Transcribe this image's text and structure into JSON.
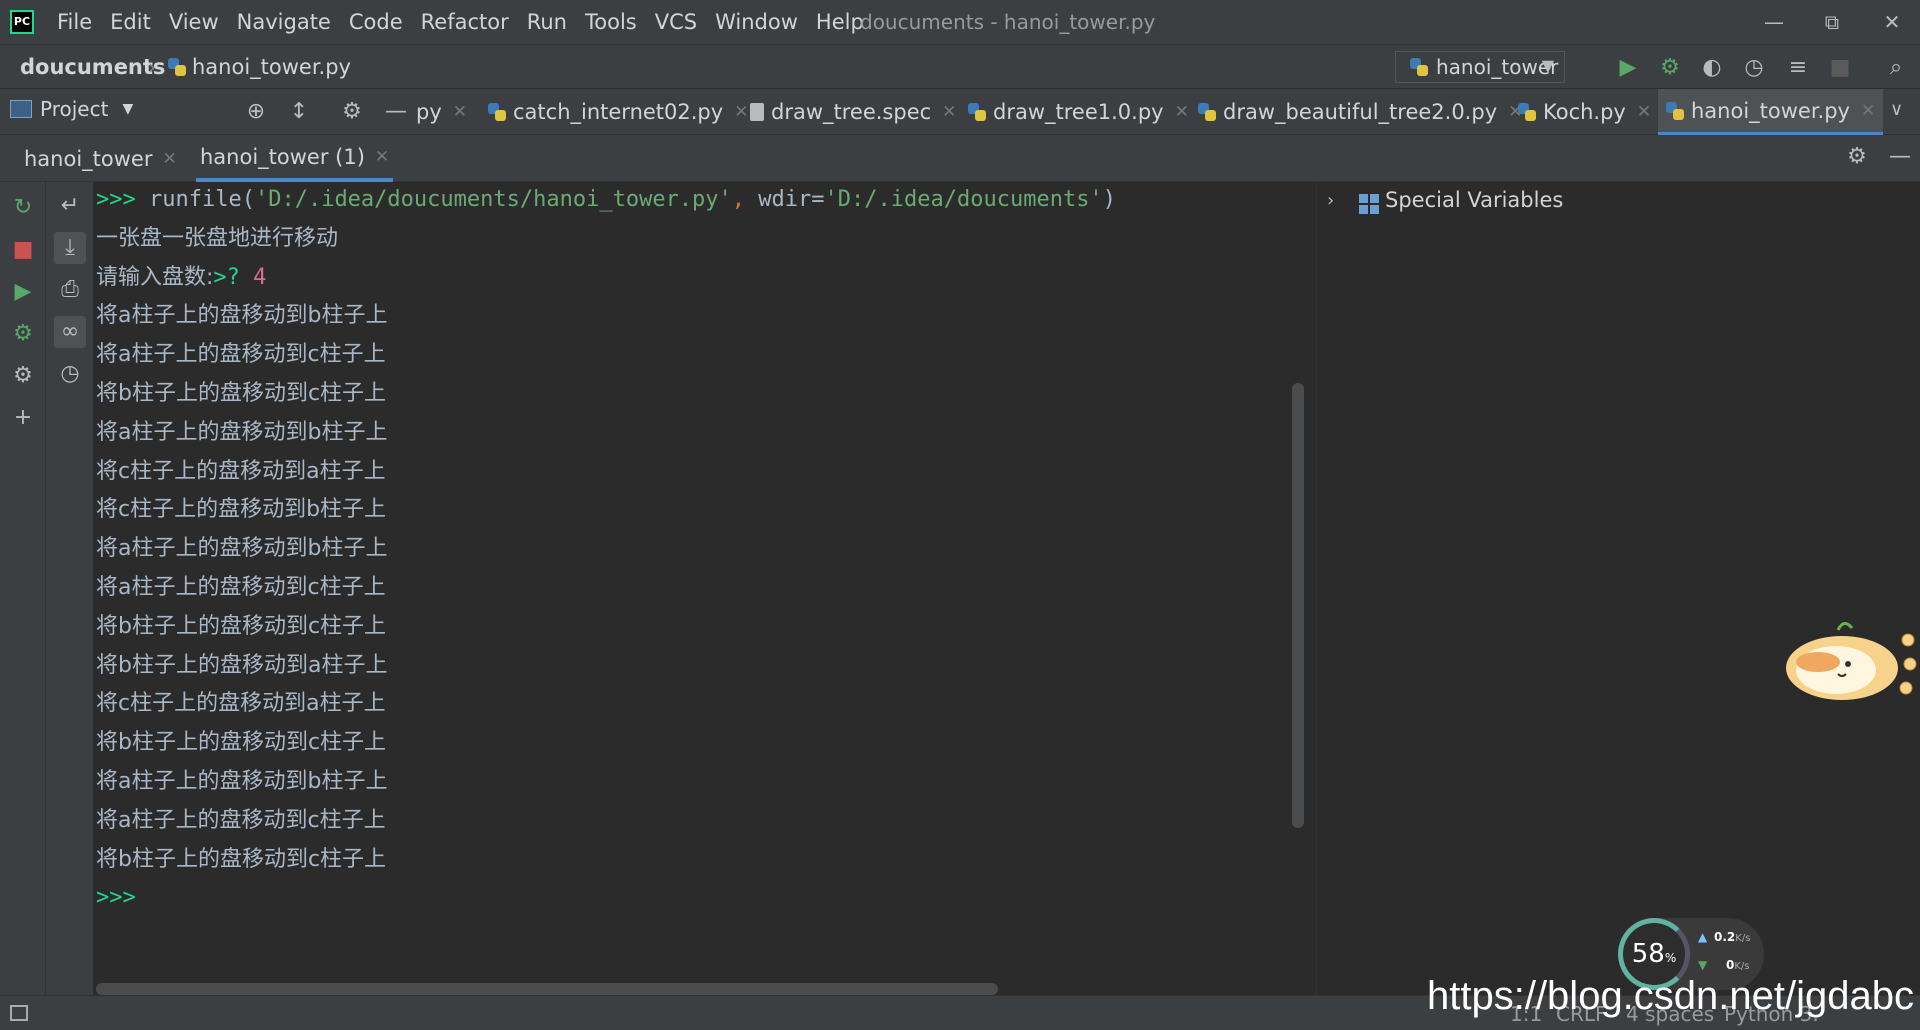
{
  "app": {
    "logo": "PC",
    "menu": [
      "File",
      "Edit",
      "View",
      "Navigate",
      "Code",
      "Refactor",
      "Run",
      "Tools",
      "VCS",
      "Window",
      "Help"
    ],
    "window_title": "doucuments - hanoi_tower.py"
  },
  "nav": {
    "root": "doucuments",
    "file": "hanoi_tower.py",
    "run_config": "hanoi_tower"
  },
  "tabs": {
    "project_label": "Project",
    "editor_tabs": [
      {
        "label": "py",
        "icon": "python-file-icon"
      },
      {
        "label": "catch_internet02.py",
        "icon": "python-file-icon"
      },
      {
        "label": "draw_tree.spec",
        "icon": "text-file-icon"
      },
      {
        "label": "draw_tree1.0.py",
        "icon": "python-file-icon"
      },
      {
        "label": "draw_beautiful_tree2.0.py",
        "icon": "python-file-icon"
      },
      {
        "label": "Koch.py",
        "icon": "python-file-icon"
      },
      {
        "label": "hanoi_tower.py",
        "icon": "python-file-icon",
        "active": true
      }
    ]
  },
  "console_tabs": [
    "hanoi_tower",
    "hanoi_tower (1)"
  ],
  "console": {
    "prompt": ">>>",
    "cmd_prefix": " runfile(",
    "cmd_path": "'D:/.idea/doucuments/hanoi_tower.py'",
    "cmd_comma": ", ",
    "cmd_kw": "wdir=",
    "cmd_wdir": "'D:/.idea/doucuments'",
    "cmd_suffix": ")",
    "intro": "一张盘一张盘地进行移动",
    "input_prompt": "请输入盘数:",
    "input_marker": ">? ",
    "input_value": "4",
    "moves": [
      "将a柱子上的盘移动到b柱子上",
      "将a柱子上的盘移动到c柱子上",
      "将b柱子上的盘移动到c柱子上",
      "将a柱子上的盘移动到b柱子上",
      "将c柱子上的盘移动到a柱子上",
      "将c柱子上的盘移动到b柱子上",
      "将a柱子上的盘移动到b柱子上",
      "将a柱子上的盘移动到c柱子上",
      "将b柱子上的盘移动到c柱子上",
      "将b柱子上的盘移动到a柱子上",
      "将c柱子上的盘移动到a柱子上",
      "将b柱子上的盘移动到c柱子上",
      "将a柱子上的盘移动到b柱子上",
      "将a柱子上的盘移动到c柱子上",
      "将b柱子上的盘移动到c柱子上"
    ],
    "final_prompt": ">>>"
  },
  "variables": {
    "label": "Special Variables"
  },
  "widget": {
    "cpu_percent": "58",
    "cpu_unit": "%",
    "upload": "0.2",
    "upload_unit": "K/s",
    "download": "0",
    "download_unit": "K/s"
  },
  "status": {
    "position": "1:1",
    "line_sep": "CRLF",
    "indent": "4 spaces",
    "interpreter": "Python 3."
  },
  "watermark": "https://blog.csdn.net/jgdabc",
  "colors": {
    "prompt_green": "#21d789",
    "string_green": "#6aab73",
    "accent_blue": "#4a88c7",
    "input_pink": "#e06c8a"
  }
}
